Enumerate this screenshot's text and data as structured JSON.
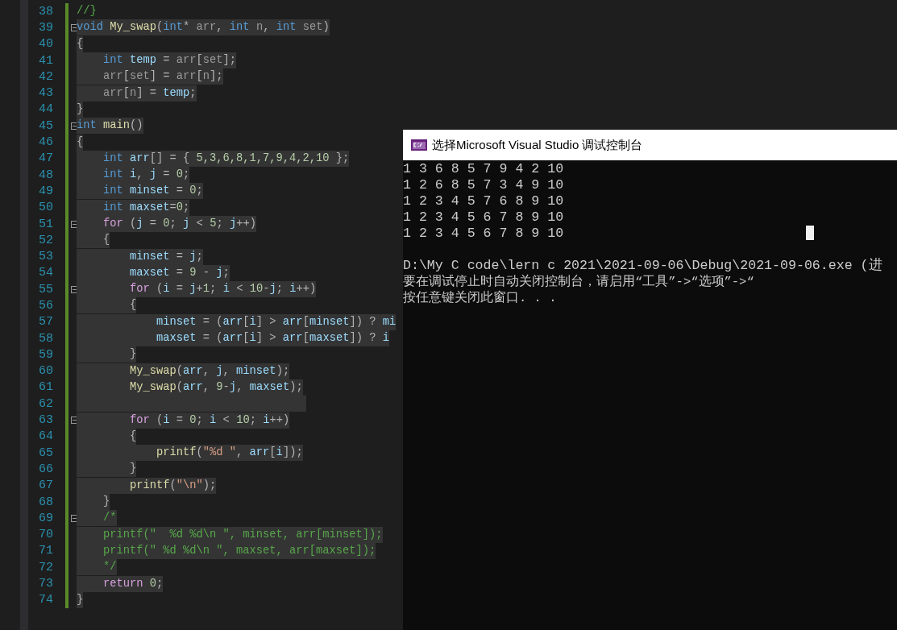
{
  "editor": {
    "lines": [
      {
        "number": "38",
        "selected": false,
        "fold": false,
        "modified": true,
        "tokens": [
          {
            "kind": "comment",
            "text": "//}"
          }
        ]
      },
      {
        "number": "39",
        "selected": true,
        "fold": true,
        "modified": true,
        "tokens": [
          {
            "kind": "keyword",
            "text": "void "
          },
          {
            "kind": "function",
            "text": "My_swap"
          },
          {
            "kind": "plain",
            "text": "("
          },
          {
            "kind": "keyword",
            "text": "int"
          },
          {
            "kind": "plain",
            "text": "* "
          },
          {
            "kind": "param",
            "text": "arr"
          },
          {
            "kind": "plain",
            "text": ", "
          },
          {
            "kind": "keyword",
            "text": "int "
          },
          {
            "kind": "param",
            "text": "n"
          },
          {
            "kind": "plain",
            "text": ", "
          },
          {
            "kind": "keyword",
            "text": "int "
          },
          {
            "kind": "param",
            "text": "set"
          },
          {
            "kind": "plain",
            "text": ")"
          }
        ]
      },
      {
        "number": "40",
        "selected": true,
        "fold": false,
        "modified": true,
        "tokens": [
          {
            "kind": "plain",
            "text": "{"
          }
        ]
      },
      {
        "number": "41",
        "selected": true,
        "fold": false,
        "modified": true,
        "tokens": [
          {
            "kind": "keyword",
            "text": "    int "
          },
          {
            "kind": "local",
            "text": "temp"
          },
          {
            "kind": "plain",
            "text": " = "
          },
          {
            "kind": "param",
            "text": "arr"
          },
          {
            "kind": "plain",
            "text": "["
          },
          {
            "kind": "param",
            "text": "set"
          },
          {
            "kind": "plain",
            "text": "];"
          }
        ]
      },
      {
        "number": "42",
        "selected": true,
        "fold": false,
        "modified": true,
        "tokens": [
          {
            "kind": "param",
            "text": "    arr"
          },
          {
            "kind": "plain",
            "text": "["
          },
          {
            "kind": "param",
            "text": "set"
          },
          {
            "kind": "plain",
            "text": "] = "
          },
          {
            "kind": "param",
            "text": "arr"
          },
          {
            "kind": "plain",
            "text": "["
          },
          {
            "kind": "param",
            "text": "n"
          },
          {
            "kind": "plain",
            "text": "];"
          }
        ]
      },
      {
        "number": "43",
        "selected": true,
        "fold": false,
        "modified": true,
        "tokens": [
          {
            "kind": "param",
            "text": "    arr"
          },
          {
            "kind": "plain",
            "text": "["
          },
          {
            "kind": "param",
            "text": "n"
          },
          {
            "kind": "plain",
            "text": "] = "
          },
          {
            "kind": "local",
            "text": "temp"
          },
          {
            "kind": "plain",
            "text": ";"
          }
        ]
      },
      {
        "number": "44",
        "selected": true,
        "fold": false,
        "modified": true,
        "tokens": [
          {
            "kind": "plain",
            "text": "}"
          }
        ]
      },
      {
        "number": "45",
        "selected": true,
        "fold": true,
        "modified": true,
        "tokens": [
          {
            "kind": "keyword",
            "text": "int "
          },
          {
            "kind": "function",
            "text": "main"
          },
          {
            "kind": "plain",
            "text": "()"
          }
        ]
      },
      {
        "number": "46",
        "selected": true,
        "fold": false,
        "modified": true,
        "tokens": [
          {
            "kind": "plain",
            "text": "{"
          }
        ]
      },
      {
        "number": "47",
        "selected": true,
        "fold": false,
        "modified": true,
        "tokens": [
          {
            "kind": "keyword",
            "text": "    int "
          },
          {
            "kind": "local",
            "text": "arr"
          },
          {
            "kind": "plain",
            "text": "[] = { "
          },
          {
            "kind": "number",
            "text": "5,3,6,8,1,7,9,4,2,10"
          },
          {
            "kind": "plain",
            "text": " };"
          }
        ]
      },
      {
        "number": "48",
        "selected": true,
        "fold": false,
        "modified": true,
        "tokens": [
          {
            "kind": "keyword",
            "text": "    int "
          },
          {
            "kind": "local",
            "text": "i"
          },
          {
            "kind": "plain",
            "text": ", "
          },
          {
            "kind": "local",
            "text": "j"
          },
          {
            "kind": "plain",
            "text": " = "
          },
          {
            "kind": "number",
            "text": "0"
          },
          {
            "kind": "plain",
            "text": ";"
          }
        ]
      },
      {
        "number": "49",
        "selected": true,
        "fold": false,
        "modified": true,
        "tokens": [
          {
            "kind": "keyword",
            "text": "    int "
          },
          {
            "kind": "local",
            "text": "minset"
          },
          {
            "kind": "plain",
            "text": " = "
          },
          {
            "kind": "number",
            "text": "0"
          },
          {
            "kind": "plain",
            "text": ";"
          }
        ]
      },
      {
        "number": "50",
        "selected": true,
        "fold": false,
        "modified": true,
        "tokens": [
          {
            "kind": "keyword",
            "text": "    int "
          },
          {
            "kind": "local",
            "text": "maxset"
          },
          {
            "kind": "plain",
            "text": "="
          },
          {
            "kind": "number",
            "text": "0"
          },
          {
            "kind": "plain",
            "text": ";"
          }
        ]
      },
      {
        "number": "51",
        "selected": true,
        "fold": true,
        "modified": true,
        "tokens": [
          {
            "kind": "control",
            "text": "    for"
          },
          {
            "kind": "plain",
            "text": " ("
          },
          {
            "kind": "local",
            "text": "j"
          },
          {
            "kind": "plain",
            "text": " = "
          },
          {
            "kind": "number",
            "text": "0"
          },
          {
            "kind": "plain",
            "text": "; "
          },
          {
            "kind": "local",
            "text": "j"
          },
          {
            "kind": "plain",
            "text": " < "
          },
          {
            "kind": "number",
            "text": "5"
          },
          {
            "kind": "plain",
            "text": "; "
          },
          {
            "kind": "local",
            "text": "j"
          },
          {
            "kind": "plain",
            "text": "++)"
          }
        ]
      },
      {
        "number": "52",
        "selected": true,
        "fold": false,
        "modified": true,
        "tokens": [
          {
            "kind": "plain",
            "text": "    {"
          }
        ]
      },
      {
        "number": "53",
        "selected": true,
        "fold": false,
        "modified": true,
        "tokens": [
          {
            "kind": "local",
            "text": "        minset"
          },
          {
            "kind": "plain",
            "text": " = "
          },
          {
            "kind": "local",
            "text": "j"
          },
          {
            "kind": "plain",
            "text": ";"
          }
        ]
      },
      {
        "number": "54",
        "selected": true,
        "fold": false,
        "modified": true,
        "tokens": [
          {
            "kind": "local",
            "text": "        maxset"
          },
          {
            "kind": "plain",
            "text": " = "
          },
          {
            "kind": "number",
            "text": "9"
          },
          {
            "kind": "plain",
            "text": " - "
          },
          {
            "kind": "local",
            "text": "j"
          },
          {
            "kind": "plain",
            "text": ";"
          }
        ]
      },
      {
        "number": "55",
        "selected": true,
        "fold": true,
        "modified": true,
        "tokens": [
          {
            "kind": "control",
            "text": "        for"
          },
          {
            "kind": "plain",
            "text": " ("
          },
          {
            "kind": "local",
            "text": "i"
          },
          {
            "kind": "plain",
            "text": " = "
          },
          {
            "kind": "local",
            "text": "j"
          },
          {
            "kind": "plain",
            "text": "+"
          },
          {
            "kind": "number",
            "text": "1"
          },
          {
            "kind": "plain",
            "text": "; "
          },
          {
            "kind": "local",
            "text": "i"
          },
          {
            "kind": "plain",
            "text": " < "
          },
          {
            "kind": "number",
            "text": "10"
          },
          {
            "kind": "plain",
            "text": "-"
          },
          {
            "kind": "local",
            "text": "j"
          },
          {
            "kind": "plain",
            "text": "; "
          },
          {
            "kind": "local",
            "text": "i"
          },
          {
            "kind": "plain",
            "text": "++)"
          }
        ]
      },
      {
        "number": "56",
        "selected": true,
        "fold": false,
        "modified": true,
        "tokens": [
          {
            "kind": "plain",
            "text": "        {"
          }
        ]
      },
      {
        "number": "57",
        "selected": true,
        "fold": false,
        "modified": true,
        "tokens": [
          {
            "kind": "local",
            "text": "            minset"
          },
          {
            "kind": "plain",
            "text": " = ("
          },
          {
            "kind": "local",
            "text": "arr"
          },
          {
            "kind": "plain",
            "text": "["
          },
          {
            "kind": "local",
            "text": "i"
          },
          {
            "kind": "plain",
            "text": "] > "
          },
          {
            "kind": "local",
            "text": "arr"
          },
          {
            "kind": "plain",
            "text": "["
          },
          {
            "kind": "local",
            "text": "minset"
          },
          {
            "kind": "plain",
            "text": "]) ? "
          },
          {
            "kind": "local",
            "text": "mi"
          }
        ]
      },
      {
        "number": "58",
        "selected": true,
        "fold": false,
        "modified": true,
        "tokens": [
          {
            "kind": "local",
            "text": "            maxset"
          },
          {
            "kind": "plain",
            "text": " = ("
          },
          {
            "kind": "local",
            "text": "arr"
          },
          {
            "kind": "plain",
            "text": "["
          },
          {
            "kind": "local",
            "text": "i"
          },
          {
            "kind": "plain",
            "text": "] > "
          },
          {
            "kind": "local",
            "text": "arr"
          },
          {
            "kind": "plain",
            "text": "["
          },
          {
            "kind": "local",
            "text": "maxset"
          },
          {
            "kind": "plain",
            "text": "]) ? "
          },
          {
            "kind": "local",
            "text": "i"
          }
        ]
      },
      {
        "number": "59",
        "selected": true,
        "fold": false,
        "modified": true,
        "tokens": [
          {
            "kind": "plain",
            "text": "        }"
          }
        ]
      },
      {
        "number": "60",
        "selected": true,
        "fold": false,
        "modified": true,
        "tokens": [
          {
            "kind": "function",
            "text": "        My_swap"
          },
          {
            "kind": "plain",
            "text": "("
          },
          {
            "kind": "local",
            "text": "arr"
          },
          {
            "kind": "plain",
            "text": ", "
          },
          {
            "kind": "local",
            "text": "j"
          },
          {
            "kind": "plain",
            "text": ", "
          },
          {
            "kind": "local",
            "text": "minset"
          },
          {
            "kind": "plain",
            "text": ");"
          }
        ]
      },
      {
        "number": "61",
        "selected": true,
        "fold": false,
        "modified": true,
        "tokens": [
          {
            "kind": "function",
            "text": "        My_swap"
          },
          {
            "kind": "plain",
            "text": "("
          },
          {
            "kind": "local",
            "text": "arr"
          },
          {
            "kind": "plain",
            "text": ", "
          },
          {
            "kind": "number",
            "text": "9"
          },
          {
            "kind": "plain",
            "text": "-"
          },
          {
            "kind": "local",
            "text": "j"
          },
          {
            "kind": "plain",
            "text": ", "
          },
          {
            "kind": "local",
            "text": "maxset"
          },
          {
            "kind": "plain",
            "text": ");"
          }
        ]
      },
      {
        "number": "62",
        "selected": true,
        "fold": false,
        "modified": true
      },
      {
        "number": "63",
        "selected": true,
        "fold": true,
        "modified": true,
        "tokens": [
          {
            "kind": "control",
            "text": "        for"
          },
          {
            "kind": "plain",
            "text": " ("
          },
          {
            "kind": "local",
            "text": "i"
          },
          {
            "kind": "plain",
            "text": " = "
          },
          {
            "kind": "number",
            "text": "0"
          },
          {
            "kind": "plain",
            "text": "; "
          },
          {
            "kind": "local",
            "text": "i"
          },
          {
            "kind": "plain",
            "text": " < "
          },
          {
            "kind": "number",
            "text": "10"
          },
          {
            "kind": "plain",
            "text": "; "
          },
          {
            "kind": "local",
            "text": "i"
          },
          {
            "kind": "plain",
            "text": "++)"
          }
        ]
      },
      {
        "number": "64",
        "selected": true,
        "fold": false,
        "modified": true,
        "tokens": [
          {
            "kind": "plain",
            "text": "        {"
          }
        ]
      },
      {
        "number": "65",
        "selected": true,
        "fold": false,
        "modified": true,
        "tokens": [
          {
            "kind": "function",
            "text": "            printf"
          },
          {
            "kind": "plain",
            "text": "("
          },
          {
            "kind": "string",
            "text": "\"%d \""
          },
          {
            "kind": "plain",
            "text": ", "
          },
          {
            "kind": "local",
            "text": "arr"
          },
          {
            "kind": "plain",
            "text": "["
          },
          {
            "kind": "local",
            "text": "i"
          },
          {
            "kind": "plain",
            "text": "]);"
          }
        ]
      },
      {
        "number": "66",
        "selected": true,
        "fold": false,
        "modified": true,
        "tokens": [
          {
            "kind": "plain",
            "text": "        }"
          }
        ]
      },
      {
        "number": "67",
        "selected": true,
        "fold": false,
        "modified": true,
        "tokens": [
          {
            "kind": "function",
            "text": "        printf"
          },
          {
            "kind": "plain",
            "text": "("
          },
          {
            "kind": "string",
            "text": "\"\\n\""
          },
          {
            "kind": "plain",
            "text": ");"
          }
        ]
      },
      {
        "number": "68",
        "selected": true,
        "fold": false,
        "modified": true,
        "tokens": [
          {
            "kind": "plain",
            "text": "    }"
          }
        ]
      },
      {
        "number": "69",
        "selected": true,
        "fold": true,
        "modified": true,
        "tokens": [
          {
            "kind": "comment",
            "text": "    /*"
          }
        ]
      },
      {
        "number": "70",
        "selected": true,
        "fold": false,
        "modified": true,
        "tokens": [
          {
            "kind": "comment",
            "text": "    printf(\"  %d %d\\n \", minset, arr[minset]);"
          }
        ]
      },
      {
        "number": "71",
        "selected": true,
        "fold": false,
        "modified": true,
        "tokens": [
          {
            "kind": "comment",
            "text": "    printf(\" %d %d\\n \", maxset, arr[maxset]);"
          }
        ]
      },
      {
        "number": "72",
        "selected": true,
        "fold": false,
        "modified": true,
        "tokens": [
          {
            "kind": "comment",
            "text": "    */"
          }
        ]
      },
      {
        "number": "73",
        "selected": true,
        "fold": false,
        "modified": true,
        "tokens": [
          {
            "kind": "control",
            "text": "    return "
          },
          {
            "kind": "number",
            "text": "0"
          },
          {
            "kind": "plain",
            "text": ";"
          }
        ]
      },
      {
        "number": "74",
        "selected": true,
        "fold": false,
        "modified": true,
        "tokens": [
          {
            "kind": "plain",
            "text": "}"
          }
        ]
      }
    ]
  },
  "console": {
    "title": "选择Microsoft Visual Studio 调试控制台",
    "output": [
      "1 3 6 8 5 7 9 4 2 10",
      "1 2 6 8 5 7 3 4 9 10",
      "1 2 3 4 5 7 6 8 9 10",
      "1 2 3 4 5 6 7 8 9 10",
      "1 2 3 4 5 6 7 8 9 10"
    ],
    "messages": [
      "D:\\My C code\\lern c 2021\\2021-09-06\\Debug\\2021-09-06.exe (进",
      "要在调试停止时自动关闭控制台，请启用“工具”->“选项”->“",
      "按任意键关闭此窗口. . ."
    ]
  }
}
